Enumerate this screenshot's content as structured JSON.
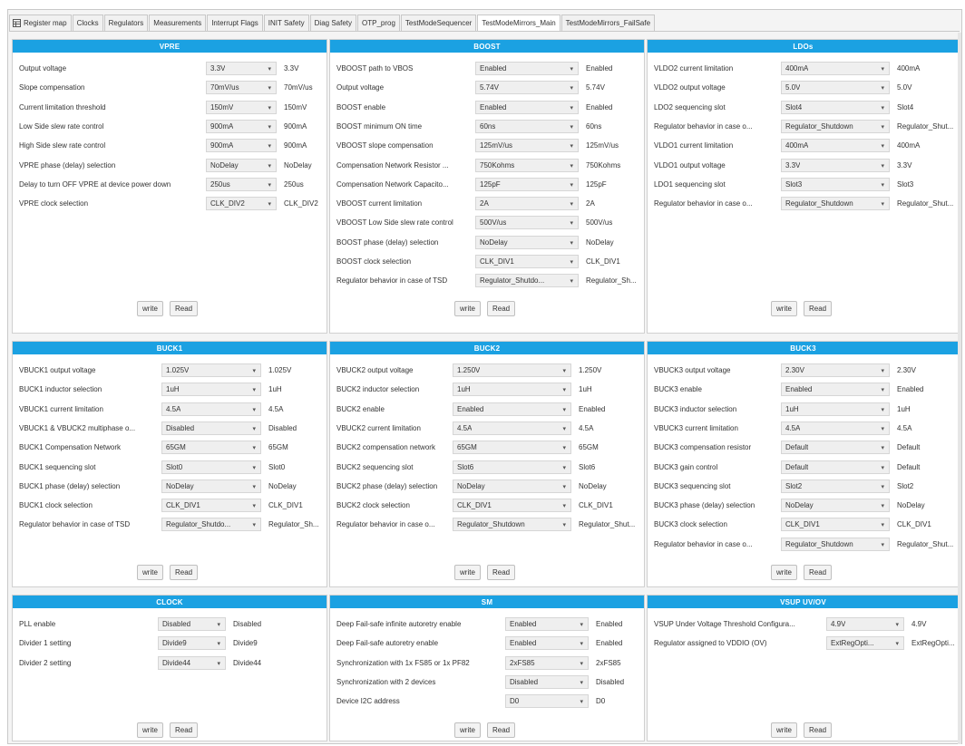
{
  "tabs": [
    {
      "label": "Register map",
      "icon": "table-icon"
    },
    {
      "label": "Clocks"
    },
    {
      "label": "Regulators"
    },
    {
      "label": "Measurements"
    },
    {
      "label": "Interrupt Flags"
    },
    {
      "label": "INIT Safety"
    },
    {
      "label": "Diag Safety"
    },
    {
      "label": "OTP_prog"
    },
    {
      "label": "TestModeSequencer"
    },
    {
      "label": "TestModeMirrors_Main",
      "active": true
    },
    {
      "label": "TestModeMirrors_FailSafe"
    }
  ],
  "accent_color": "#1ba1e2",
  "panels": {
    "vpre": {
      "title": "VPRE",
      "write": "write",
      "read": "Read",
      "rows": [
        {
          "label": "Output voltage",
          "select": "3.3V",
          "value": "3.3V"
        },
        {
          "label": "Slope compensation",
          "select": "70mV/us",
          "value": "70mV/us"
        },
        {
          "label": "Current limitation threshold",
          "select": "150mV",
          "value": "150mV"
        },
        {
          "label": "Low Side slew rate control",
          "select": "900mA",
          "value": "900mA"
        },
        {
          "label": "High Side slew rate control",
          "select": "900mA",
          "value": "900mA"
        },
        {
          "label": "VPRE phase (delay) selection",
          "select": "NoDelay",
          "value": "NoDelay"
        },
        {
          "label": "Delay to turn OFF VPRE at device power down",
          "select": "250us",
          "value": "250us"
        },
        {
          "label": "VPRE clock selection",
          "select": "CLK_DIV2",
          "value": "CLK_DIV2"
        }
      ]
    },
    "boost": {
      "title": "BOOST",
      "write": "write",
      "read": "Read",
      "rows": [
        {
          "label": "VBOOST path to VBOS",
          "select": "Enabled",
          "value": "Enabled"
        },
        {
          "label": "Output voltage",
          "select": "5.74V",
          "value": "5.74V"
        },
        {
          "label": "BOOST enable",
          "select": "Enabled",
          "value": "Enabled"
        },
        {
          "label": "BOOST minimum ON time",
          "select": "60ns",
          "value": "60ns"
        },
        {
          "label": "VBOOST slope compensation",
          "select": "125mV/us",
          "value": "125mV/us"
        },
        {
          "label": "Compensation Network Resistor ...",
          "select": "750Kohms",
          "value": "750Kohms"
        },
        {
          "label": "Compensation Network Capacito...",
          "select": "125pF",
          "value": "125pF"
        },
        {
          "label": "VBOOST current limitation",
          "select": "2A",
          "value": "2A"
        },
        {
          "label": "VBOOST Low Side slew rate control",
          "select": "500V/us",
          "value": "500V/us"
        },
        {
          "label": "BOOST phase (delay) selection",
          "select": "NoDelay",
          "value": "NoDelay"
        },
        {
          "label": "BOOST clock selection",
          "select": "CLK_DIV1",
          "value": "CLK_DIV1"
        },
        {
          "label": "Regulator behavior in case of TSD",
          "select": "Regulator_Shutdo...",
          "value": "Regulator_Sh..."
        }
      ]
    },
    "ldos": {
      "title": "LDOs",
      "write": "write",
      "read": "Read",
      "rows": [
        {
          "label": "VLDO2 current limitation",
          "select": "400mA",
          "value": "400mA"
        },
        {
          "label": "VLDO2 output voltage",
          "select": "5.0V",
          "value": "5.0V"
        },
        {
          "label": "LDO2 sequencing slot",
          "select": "Slot4",
          "value": "Slot4"
        },
        {
          "label": "Regulator behavior in case o...",
          "select": "Regulator_Shutdown",
          "value": "Regulator_Shut..."
        },
        {
          "label": "VLDO1 current limitation",
          "select": "400mA",
          "value": "400mA"
        },
        {
          "label": "VLDO1 output voltage",
          "select": "3.3V",
          "value": "3.3V"
        },
        {
          "label": "LDO1 sequencing slot",
          "select": "Slot3",
          "value": "Slot3"
        },
        {
          "label": "Regulator behavior in case o...",
          "select": "Regulator_Shutdown",
          "value": "Regulator_Shut..."
        }
      ]
    },
    "buck1": {
      "title": "BUCK1",
      "write": "write",
      "read": "Read",
      "rows": [
        {
          "label": "VBUCK1 output voltage",
          "select": "1.025V",
          "value": "1.025V"
        },
        {
          "label": "BUCK1 inductor selection",
          "select": "1uH",
          "value": "1uH"
        },
        {
          "label": "VBUCK1 current limitation",
          "select": "4.5A",
          "value": "4.5A"
        },
        {
          "label": "VBUCK1 & VBUCK2 multiphase o...",
          "select": "Disabled",
          "value": "Disabled"
        },
        {
          "label": "BUCK1 Compensation Network",
          "select": "65GM",
          "value": "65GM"
        },
        {
          "label": "BUCK1 sequencing slot",
          "select": "Slot0",
          "value": "Slot0"
        },
        {
          "label": "BUCK1 phase (delay) selection",
          "select": "NoDelay",
          "value": "NoDelay"
        },
        {
          "label": "BUCK1 clock selection",
          "select": "CLK_DIV1",
          "value": "CLK_DIV1"
        },
        {
          "label": "Regulator behavior in case of TSD",
          "select": "Regulator_Shutdo...",
          "value": "Regulator_Sh..."
        }
      ]
    },
    "buck2": {
      "title": "BUCK2",
      "write": "write",
      "read": "Read",
      "rows": [
        {
          "label": "VBUCK2 output voltage",
          "select": "1.250V",
          "value": "1.250V"
        },
        {
          "label": "BUCK2 inductor selection",
          "select": "1uH",
          "value": "1uH"
        },
        {
          "label": "BUCK2 enable",
          "select": "Enabled",
          "value": "Enabled"
        },
        {
          "label": "VBUCK2 current limitation",
          "select": "4.5A",
          "value": "4.5A"
        },
        {
          "label": "BUCK2 compensation network",
          "select": "65GM",
          "value": "65GM"
        },
        {
          "label": "BUCK2 sequencing slot",
          "select": "Slot6",
          "value": "Slot6"
        },
        {
          "label": "BUCK2 phase (delay) selection",
          "select": "NoDelay",
          "value": "NoDelay"
        },
        {
          "label": "BUCK2 clock selection",
          "select": "CLK_DIV1",
          "value": "CLK_DIV1"
        },
        {
          "label": "Regulator behavior in case o...",
          "select": "Regulator_Shutdown",
          "value": "Regulator_Shut..."
        }
      ]
    },
    "buck3": {
      "title": "BUCK3",
      "write": "write",
      "read": "Read",
      "rows": [
        {
          "label": "VBUCK3 output voltage",
          "select": "2.30V",
          "value": "2.30V"
        },
        {
          "label": "BUCK3 enable",
          "select": "Enabled",
          "value": "Enabled"
        },
        {
          "label": "BUCK3 inductor selection",
          "select": "1uH",
          "value": "1uH"
        },
        {
          "label": "VBUCK3 current limitation",
          "select": "4.5A",
          "value": "4.5A"
        },
        {
          "label": "BUCK3 compensation resistor",
          "select": "Default",
          "value": "Default"
        },
        {
          "label": "BUCK3 gain control",
          "select": "Default",
          "value": "Default"
        },
        {
          "label": "BUCK3 sequencing slot",
          "select": "Slot2",
          "value": "Slot2"
        },
        {
          "label": "BUCK3 phase (delay) selection",
          "select": "NoDelay",
          "value": "NoDelay"
        },
        {
          "label": "BUCK3 clock selection",
          "select": "CLK_DIV1",
          "value": "CLK_DIV1"
        },
        {
          "label": "Regulator behavior in case o...",
          "select": "Regulator_Shutdown",
          "value": "Regulator_Shut..."
        }
      ]
    },
    "clock": {
      "title": "CLOCK",
      "write": "write",
      "read": "Read",
      "rows": [
        {
          "label": "PLL enable",
          "select": "Disabled",
          "value": "Disabled"
        },
        {
          "label": "Divider 1 setting",
          "select": "Divide9",
          "value": "Divide9"
        },
        {
          "label": "Divider 2 setting",
          "select": "Divide44",
          "value": "Divide44"
        }
      ]
    },
    "sm": {
      "title": "SM",
      "write": "write",
      "read": "Read",
      "rows": [
        {
          "label": "Deep Fail-safe infinite autoretry enable",
          "select": "Enabled",
          "value": "Enabled"
        },
        {
          "label": "Deep Fail-safe autoretry enable",
          "select": "Enabled",
          "value": "Enabled"
        },
        {
          "label": "Synchronization with 1x FS85 or 1x PF82",
          "select": "2xFS85",
          "value": "2xFS85"
        },
        {
          "label": "Synchronization with 2 devices",
          "select": "Disabled",
          "value": "Disabled"
        },
        {
          "label": "Device I2C address",
          "select": "D0",
          "value": "D0"
        }
      ]
    },
    "vsup": {
      "title": "VSUP UV/OV",
      "write": "write",
      "read": "Read",
      "rows": [
        {
          "label": "VSUP Under Voltage Threshold Configura...",
          "select": "4.9V",
          "value": "4.9V"
        },
        {
          "label": "Regulator assigned to VDDIO (OV)",
          "select": "ExtRegOpti...",
          "value": "ExtRegOpti..."
        }
      ]
    }
  }
}
